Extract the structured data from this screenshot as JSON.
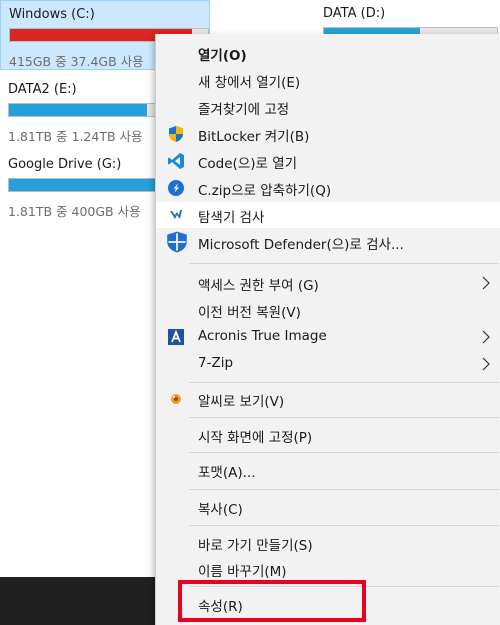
{
  "drives": [
    {
      "name": "Windows (C:)",
      "usage": "415GB 중 37.4GB 사용",
      "used_fraction": 0.91
    },
    {
      "name": "DATA (D:)",
      "usage": "",
      "used_fraction": 0.55
    },
    {
      "name": "DATA2 (E:)",
      "usage": "1.81TB 중 1.24TB 사용",
      "used_fraction": 0.69
    },
    {
      "name": "Google Drive (G:)",
      "usage": "1.81TB 중 400GB 사용",
      "used_fraction": 0.78
    }
  ],
  "context_menu": {
    "items": {
      "open": "열기(O)",
      "open_new_window": "새 창에서 열기(E)",
      "pin_quick_access": "즐겨찾기에 고정",
      "bitlocker": "BitLocker 켜기(B)",
      "open_with_code": "Code(으)로 열기",
      "compress_czip": "C.zip으로 압축하기(Q)",
      "explorer_scan": "탐색기 검사",
      "defender_scan": "Microsoft Defender(으)로 검사...",
      "give_access": "액세스 권한 부여 (G)",
      "restore_previous": "이전 버전 복원(V)",
      "acronis": "Acronis True Image",
      "seven_zip": "7-Zip",
      "alsee": "알씨로 보기(V)",
      "pin_start": "시작 화면에 고정(P)",
      "format": "포맷(A)...",
      "copy": "복사(C)",
      "create_shortcut": "바로 가기 만들기(S)",
      "rename": "이름 바꾸기(M)",
      "properties": "속성(R)"
    }
  },
  "colors": {
    "highlight_border": "#e8001c",
    "drive_bar_normal": "#26a0da",
    "drive_bar_full": "#da2626",
    "selected_tile": "#cce8ff"
  }
}
